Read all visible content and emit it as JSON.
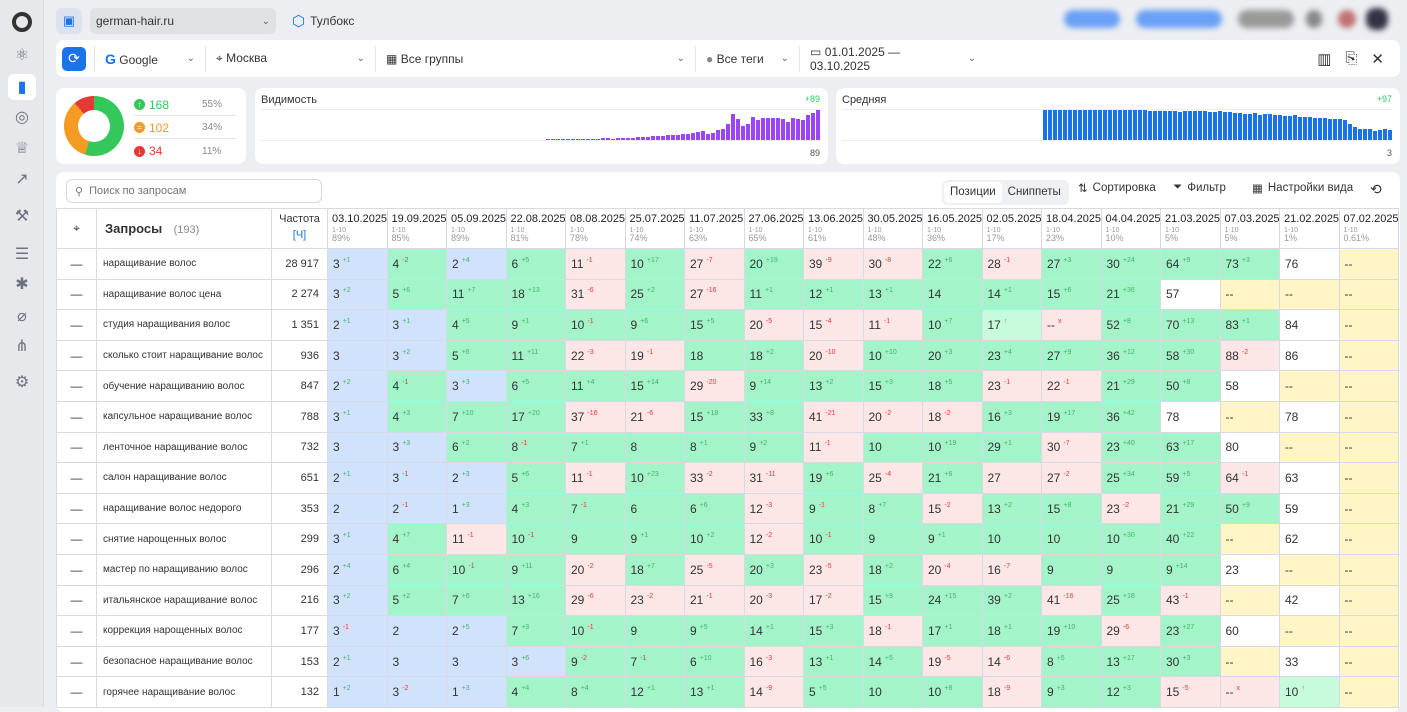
{
  "topbar": {
    "site": "german-hair.ru",
    "toolbox": "Тулбокс"
  },
  "filters": {
    "engine": "Google",
    "region": "Москва",
    "groups": "Все группы",
    "tags": "Все теги",
    "date_range": "01.01.2025 — 03.10.2025"
  },
  "summary": {
    "items": [
      {
        "count": "168",
        "pct": "55%",
        "color": "#34c759"
      },
      {
        "count": "102",
        "pct": "34%",
        "color": "#f59a23"
      },
      {
        "count": "34",
        "pct": "11%",
        "color": "#e53935"
      }
    ]
  },
  "visibility": {
    "title": "Видимость",
    "delta": "+89",
    "last": "89",
    "color": "#9b45f5",
    "values": [
      1,
      1,
      1,
      1,
      1,
      1,
      1,
      2,
      2,
      2,
      2,
      3,
      3,
      2,
      3,
      3,
      4,
      4,
      5,
      5,
      6,
      7,
      7,
      8,
      9,
      9,
      10,
      11,
      12,
      14,
      16,
      18,
      12,
      14,
      20,
      22,
      30,
      50,
      40,
      28,
      30,
      45,
      38,
      42,
      42,
      42,
      42,
      40,
      35,
      42,
      40,
      38,
      48,
      52,
      58
    ]
  },
  "average": {
    "title": "Средняя",
    "delta": "+97",
    "last": "3",
    "color": "#1a73e8",
    "values": [
      97,
      97,
      97,
      97,
      97,
      97,
      97,
      97,
      97,
      97,
      97,
      97,
      97,
      97,
      97,
      97,
      97,
      96,
      97,
      96,
      96,
      95,
      95,
      94,
      93,
      93,
      93,
      92,
      94,
      94,
      94,
      93,
      95,
      92,
      92,
      95,
      90,
      90,
      88,
      87,
      85,
      84,
      86,
      80,
      85,
      83,
      80,
      80,
      79,
      77,
      82,
      74,
      74,
      74,
      72,
      72,
      70,
      69,
      69,
      68,
      64,
      52,
      43,
      35,
      35,
      35,
      30,
      32,
      37,
      33
    ]
  },
  "toolbar": {
    "search_placeholder": "Поиск по запросам",
    "tab_positions": "Позиции",
    "tab_snippets": "Сниппеты",
    "sort": "Сортировка",
    "filter": "Фильтр",
    "view_settings": "Настройки вида"
  },
  "table": {
    "queries_label": "Запросы",
    "queries_count": "(193)",
    "freq_label": "Частота",
    "freq_sub": "[Ч]",
    "dates": [
      {
        "date": "03.10.2025",
        "range": "1-10",
        "pct": "89%"
      },
      {
        "date": "19.09.2025",
        "range": "1-10",
        "pct": "85%"
      },
      {
        "date": "05.09.2025",
        "range": "1-10",
        "pct": "89%"
      },
      {
        "date": "22.08.2025",
        "range": "1-10",
        "pct": "81%"
      },
      {
        "date": "08.08.2025",
        "range": "1-10",
        "pct": "78%"
      },
      {
        "date": "25.07.2025",
        "range": "1-10",
        "pct": "74%"
      },
      {
        "date": "11.07.2025",
        "range": "1-10",
        "pct": "63%"
      },
      {
        "date": "27.06.2025",
        "range": "1-10",
        "pct": "65%"
      },
      {
        "date": "13.06.2025",
        "range": "1-10",
        "pct": "61%"
      },
      {
        "date": "30.05.2025",
        "range": "1-10",
        "pct": "48%"
      },
      {
        "date": "16.05.2025",
        "range": "1-10",
        "pct": "36%"
      },
      {
        "date": "02.05.2025",
        "range": "1-10",
        "pct": "17%"
      },
      {
        "date": "18.04.2025",
        "range": "1-10",
        "pct": "23%"
      },
      {
        "date": "04.04.2025",
        "range": "1-10",
        "pct": "10%"
      },
      {
        "date": "21.03.2025",
        "range": "1-10",
        "pct": "5%"
      },
      {
        "date": "07.03.2025",
        "range": "1-10",
        "pct": "5%"
      },
      {
        "date": "21.02.2025",
        "range": "1-10",
        "pct": "1%"
      },
      {
        "date": "07.02.2025",
        "range": "1-10",
        "pct": "0.61%"
      }
    ],
    "rows": [
      {
        "q": "наращивание волос",
        "f": "28 917",
        "c": [
          "3|+1|b",
          "4|-2|g",
          "2|+4|b",
          "6|+5|g",
          "11|-1|r",
          "10|+17|g",
          "27|-7|r",
          "20|+19|g",
          "39|-9|r",
          "30|-8|r",
          "22|+6|g",
          "28|-1|r",
          "27|+3|g",
          "30|+24|g",
          "64|+9|g",
          "73|+3|g",
          "76||w",
          "--||y"
        ]
      },
      {
        "q": "наращивание волос цена",
        "f": "2 274",
        "c": [
          "3|+2|b",
          "5|+6|g",
          "11|+7|g",
          "18|+13|g",
          "31|-6|r",
          "25|+2|g",
          "27|-16|r",
          "11|+1|g",
          "12|+1|g",
          "13|+1|g",
          "14||g",
          "14|+1|g",
          "15|+6|g",
          "21|+36|g",
          "57||w",
          "--||y",
          "--||y",
          "--||y"
        ]
      },
      {
        "q": "студия наращивания волос",
        "f": "1 351",
        "c": [
          "2|+1|b",
          "3|+1|b",
          "4|+5|g",
          "9|+1|g",
          "10|-1|g",
          "9|+6|g",
          "15|+5|g",
          "20|-5|r",
          "15|-4|r",
          "11|-1|r",
          "10|+7|g",
          "17|↑|l",
          "--|x|r",
          "52|+8|g",
          "70|+13|g",
          "83|+1|g",
          "84||w",
          "--||y"
        ]
      },
      {
        "q": "сколько стоит наращивание волос",
        "f": "936",
        "c": [
          "3||b",
          "3|+2|b",
          "5|+6|g",
          "11|+11|g",
          "22|-3|r",
          "19|-1|r",
          "18||g",
          "18|+2|g",
          "20|-10|r",
          "10|+10|g",
          "20|+3|g",
          "23|+4|g",
          "27|+9|g",
          "36|+12|g",
          "58|+30|g",
          "88|-2|r",
          "86||w",
          "--||y"
        ]
      },
      {
        "q": "обучение наращиванию волос",
        "f": "847",
        "c": [
          "2|+2|b",
          "4|-1|g",
          "3|+3|b",
          "6|+5|g",
          "11|+4|g",
          "15|+14|g",
          "29|-20|r",
          "9|+14|g",
          "13|+2|g",
          "15|+3|g",
          "18|+5|g",
          "23|-1|r",
          "22|-1|r",
          "21|+29|g",
          "50|+8|g",
          "58||w",
          "--||y",
          "--||y"
        ]
      },
      {
        "q": "капсульное наращивание волос",
        "f": "788",
        "c": [
          "3|+1|b",
          "4|+3|g",
          "7|+10|g",
          "17|+20|g",
          "37|-16|r",
          "21|-6|r",
          "15|+18|g",
          "33|+8|g",
          "41|-21|r",
          "20|-2|r",
          "18|-2|r",
          "16|+3|g",
          "19|+17|g",
          "36|+42|g",
          "78||w",
          "--||y",
          "78||w",
          "--||y"
        ]
      },
      {
        "q": "ленточное наращивание волос",
        "f": "732",
        "c": [
          "3||b",
          "3|+3|b",
          "6|+2|g",
          "8|-1|g",
          "7|+1|g",
          "8||g",
          "8|+1|g",
          "9|+2|g",
          "11|-1|r",
          "10||g",
          "10|+19|g",
          "29|+1|g",
          "30|-7|r",
          "23|+40|g",
          "63|+17|g",
          "80||w",
          "--||y",
          "--||y"
        ]
      },
      {
        "q": "салон наращивание волос",
        "f": "651",
        "c": [
          "2|+1|b",
          "3|-1|b",
          "2|+3|b",
          "5|+6|g",
          "11|-1|r",
          "10|+23|g",
          "33|-2|r",
          "31|-11|r",
          "19|+6|g",
          "25|-4|r",
          "21|+6|g",
          "27||r",
          "27|-2|r",
          "25|+34|g",
          "59|+5|g",
          "64|-1|r",
          "63||w",
          "--||y"
        ]
      },
      {
        "q": "наращивание волос недорого",
        "f": "353",
        "c": [
          "2||b",
          "2|-1|b",
          "1|+3|b",
          "4|+3|g",
          "7|-1|g",
          "6||g",
          "6|+6|g",
          "12|-3|r",
          "9|-1|g",
          "8|+7|g",
          "15|-2|r",
          "13|+2|g",
          "15|+8|g",
          "23|-2|r",
          "21|+29|g",
          "50|+9|g",
          "59||w",
          "--||y"
        ]
      },
      {
        "q": "снятие нарощенных волос",
        "f": "299",
        "c": [
          "3|+1|b",
          "4|+7|g",
          "11|-1|r",
          "10|-1|g",
          "9||g",
          "9|+1|g",
          "10|+2|g",
          "12|-2|r",
          "10|-1|g",
          "9||g",
          "9|+1|g",
          "10||g",
          "10||g",
          "10|+30|g",
          "40|+22|g",
          "--||y",
          "62||w",
          "--||y"
        ]
      },
      {
        "q": "мастер по наращиванию волос",
        "f": "296",
        "c": [
          "2|+4|b",
          "6|+4|g",
          "10|-1|g",
          "9|+11|g",
          "20|-2|r",
          "18|+7|g",
          "25|-5|r",
          "20|+3|g",
          "23|-5|r",
          "18|+2|g",
          "20|-4|r",
          "16|-7|r",
          "9||g",
          "9||g",
          "9|+14|g",
          "23||w",
          "--||y",
          "--||y"
        ]
      },
      {
        "q": "итальянское наращивание волос",
        "f": "216",
        "c": [
          "3|+2|b",
          "5|+2|g",
          "7|+6|g",
          "13|+16|g",
          "29|-6|r",
          "23|-2|r",
          "21|-1|r",
          "20|-3|r",
          "17|-2|r",
          "15|+9|g",
          "24|+15|g",
          "39|+2|g",
          "41|-16|r",
          "25|+18|g",
          "43|-1|r",
          "--||y",
          "42||w",
          "--||y"
        ]
      },
      {
        "q": "коррекция нарощенных волос",
        "f": "177",
        "c": [
          "3|-1|b",
          "2||b",
          "2|+5|b",
          "7|+3|g",
          "10|-1|g",
          "9||g",
          "9|+5|g",
          "14|+1|g",
          "15|+3|g",
          "18|-1|r",
          "17|+1|g",
          "18|+1|g",
          "19|+10|g",
          "29|-6|r",
          "23|+27|g",
          "60||w",
          "--||y",
          "--||y"
        ]
      },
      {
        "q": "безопасное наращивание волос",
        "f": "153",
        "c": [
          "2|+1|b",
          "3||b",
          "3||b",
          "3|+6|b",
          "9|-2|g",
          "7|-1|g",
          "6|+10|g",
          "16|-3|r",
          "13|+1|g",
          "14|+5|g",
          "19|-5|r",
          "14|-6|r",
          "8|+5|g",
          "13|+17|g",
          "30|+3|g",
          "--||y",
          "33||w",
          "--||y"
        ]
      },
      {
        "q": "горячее наращивание волос",
        "f": "132",
        "c": [
          "1|+2|b",
          "3|-2|b",
          "1|+3|b",
          "4|+4|g",
          "8|+4|g",
          "12|+1|g",
          "13|+1|g",
          "14|-9|r",
          "5|+5|g",
          "10||g",
          "10|+8|g",
          "18|-9|r",
          "9|+3|g",
          "12|+3|g",
          "15|-5|r",
          "--|x|r",
          "10|↑|l",
          "--||y"
        ]
      }
    ]
  }
}
